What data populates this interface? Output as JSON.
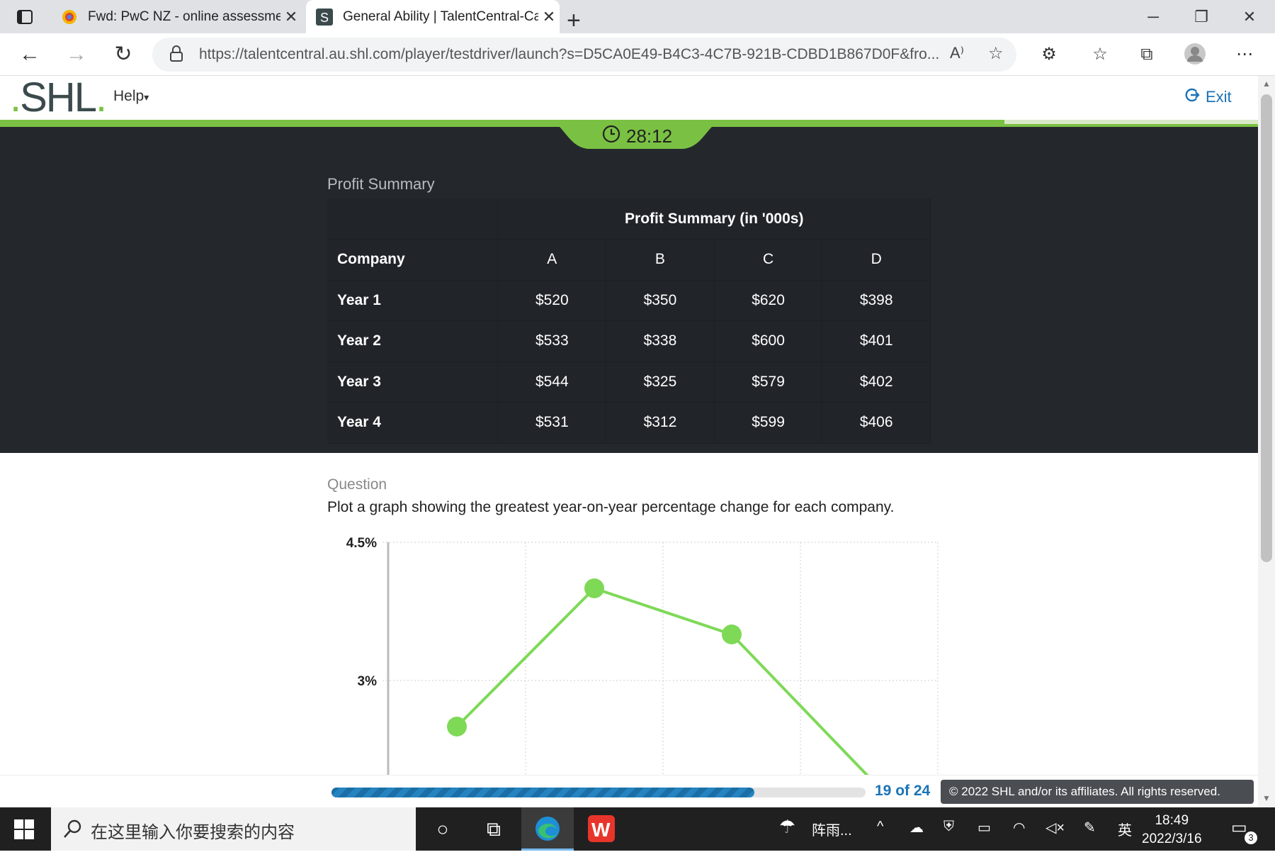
{
  "browser": {
    "tabs": [
      {
        "title": "Fwd: PwC NZ - online assessmen",
        "active": false
      },
      {
        "title": "General Ability | TalentCentral-Ca",
        "active": true
      }
    ],
    "url": "https://talentcentral.au.shl.com/player/testdriver/launch?s=D5CA0E49-B4C3-4C7B-921B-CDBD1B867D0F&fro..."
  },
  "shl": {
    "logo": "SHL",
    "help_label": "Help",
    "exit_label": "Exit",
    "timer": "28:12"
  },
  "panel": {
    "title": "Profit Summary",
    "table": {
      "caption": "Profit Summary (in '000s)",
      "row_header": "Company",
      "columns": [
        "A",
        "B",
        "C",
        "D"
      ],
      "rows": [
        {
          "label": "Year 1",
          "values": [
            "$520",
            "$350",
            "$620",
            "$398"
          ]
        },
        {
          "label": "Year 2",
          "values": [
            "$533",
            "$338",
            "$600",
            "$401"
          ]
        },
        {
          "label": "Year 3",
          "values": [
            "$544",
            "$325",
            "$579",
            "$402"
          ]
        },
        {
          "label": "Year 4",
          "values": [
            "$531",
            "$312",
            "$599",
            "$406"
          ]
        }
      ]
    }
  },
  "question": {
    "label": "Question",
    "text": "Plot a graph showing the greatest year-on-year percentage change for each company."
  },
  "chart_data": {
    "type": "line",
    "title": "",
    "xlabel": "",
    "ylabel": "",
    "ytick_labels": [
      "4.5%",
      "3%"
    ],
    "yticks": [
      4.5,
      3.0
    ],
    "ylim_visible": [
      1.95,
      4.5
    ],
    "x": [
      1,
      2,
      3,
      4
    ],
    "series": [
      {
        "values": [
          2.5,
          4.0,
          3.5,
          1.95
        ]
      }
    ],
    "grid": true,
    "color": "#7ed957"
  },
  "footer": {
    "progress_fraction": 0.792,
    "progress_text": "19 of 24",
    "copyright": "© 2022 SHL and/or its affiliates. All rights reserved."
  },
  "taskbar": {
    "search_placeholder": "在这里输入你要搜索的内容",
    "weather": "阵雨...",
    "ime": "英",
    "time": "18:49",
    "date": "2022/3/16",
    "notifications": "3"
  }
}
